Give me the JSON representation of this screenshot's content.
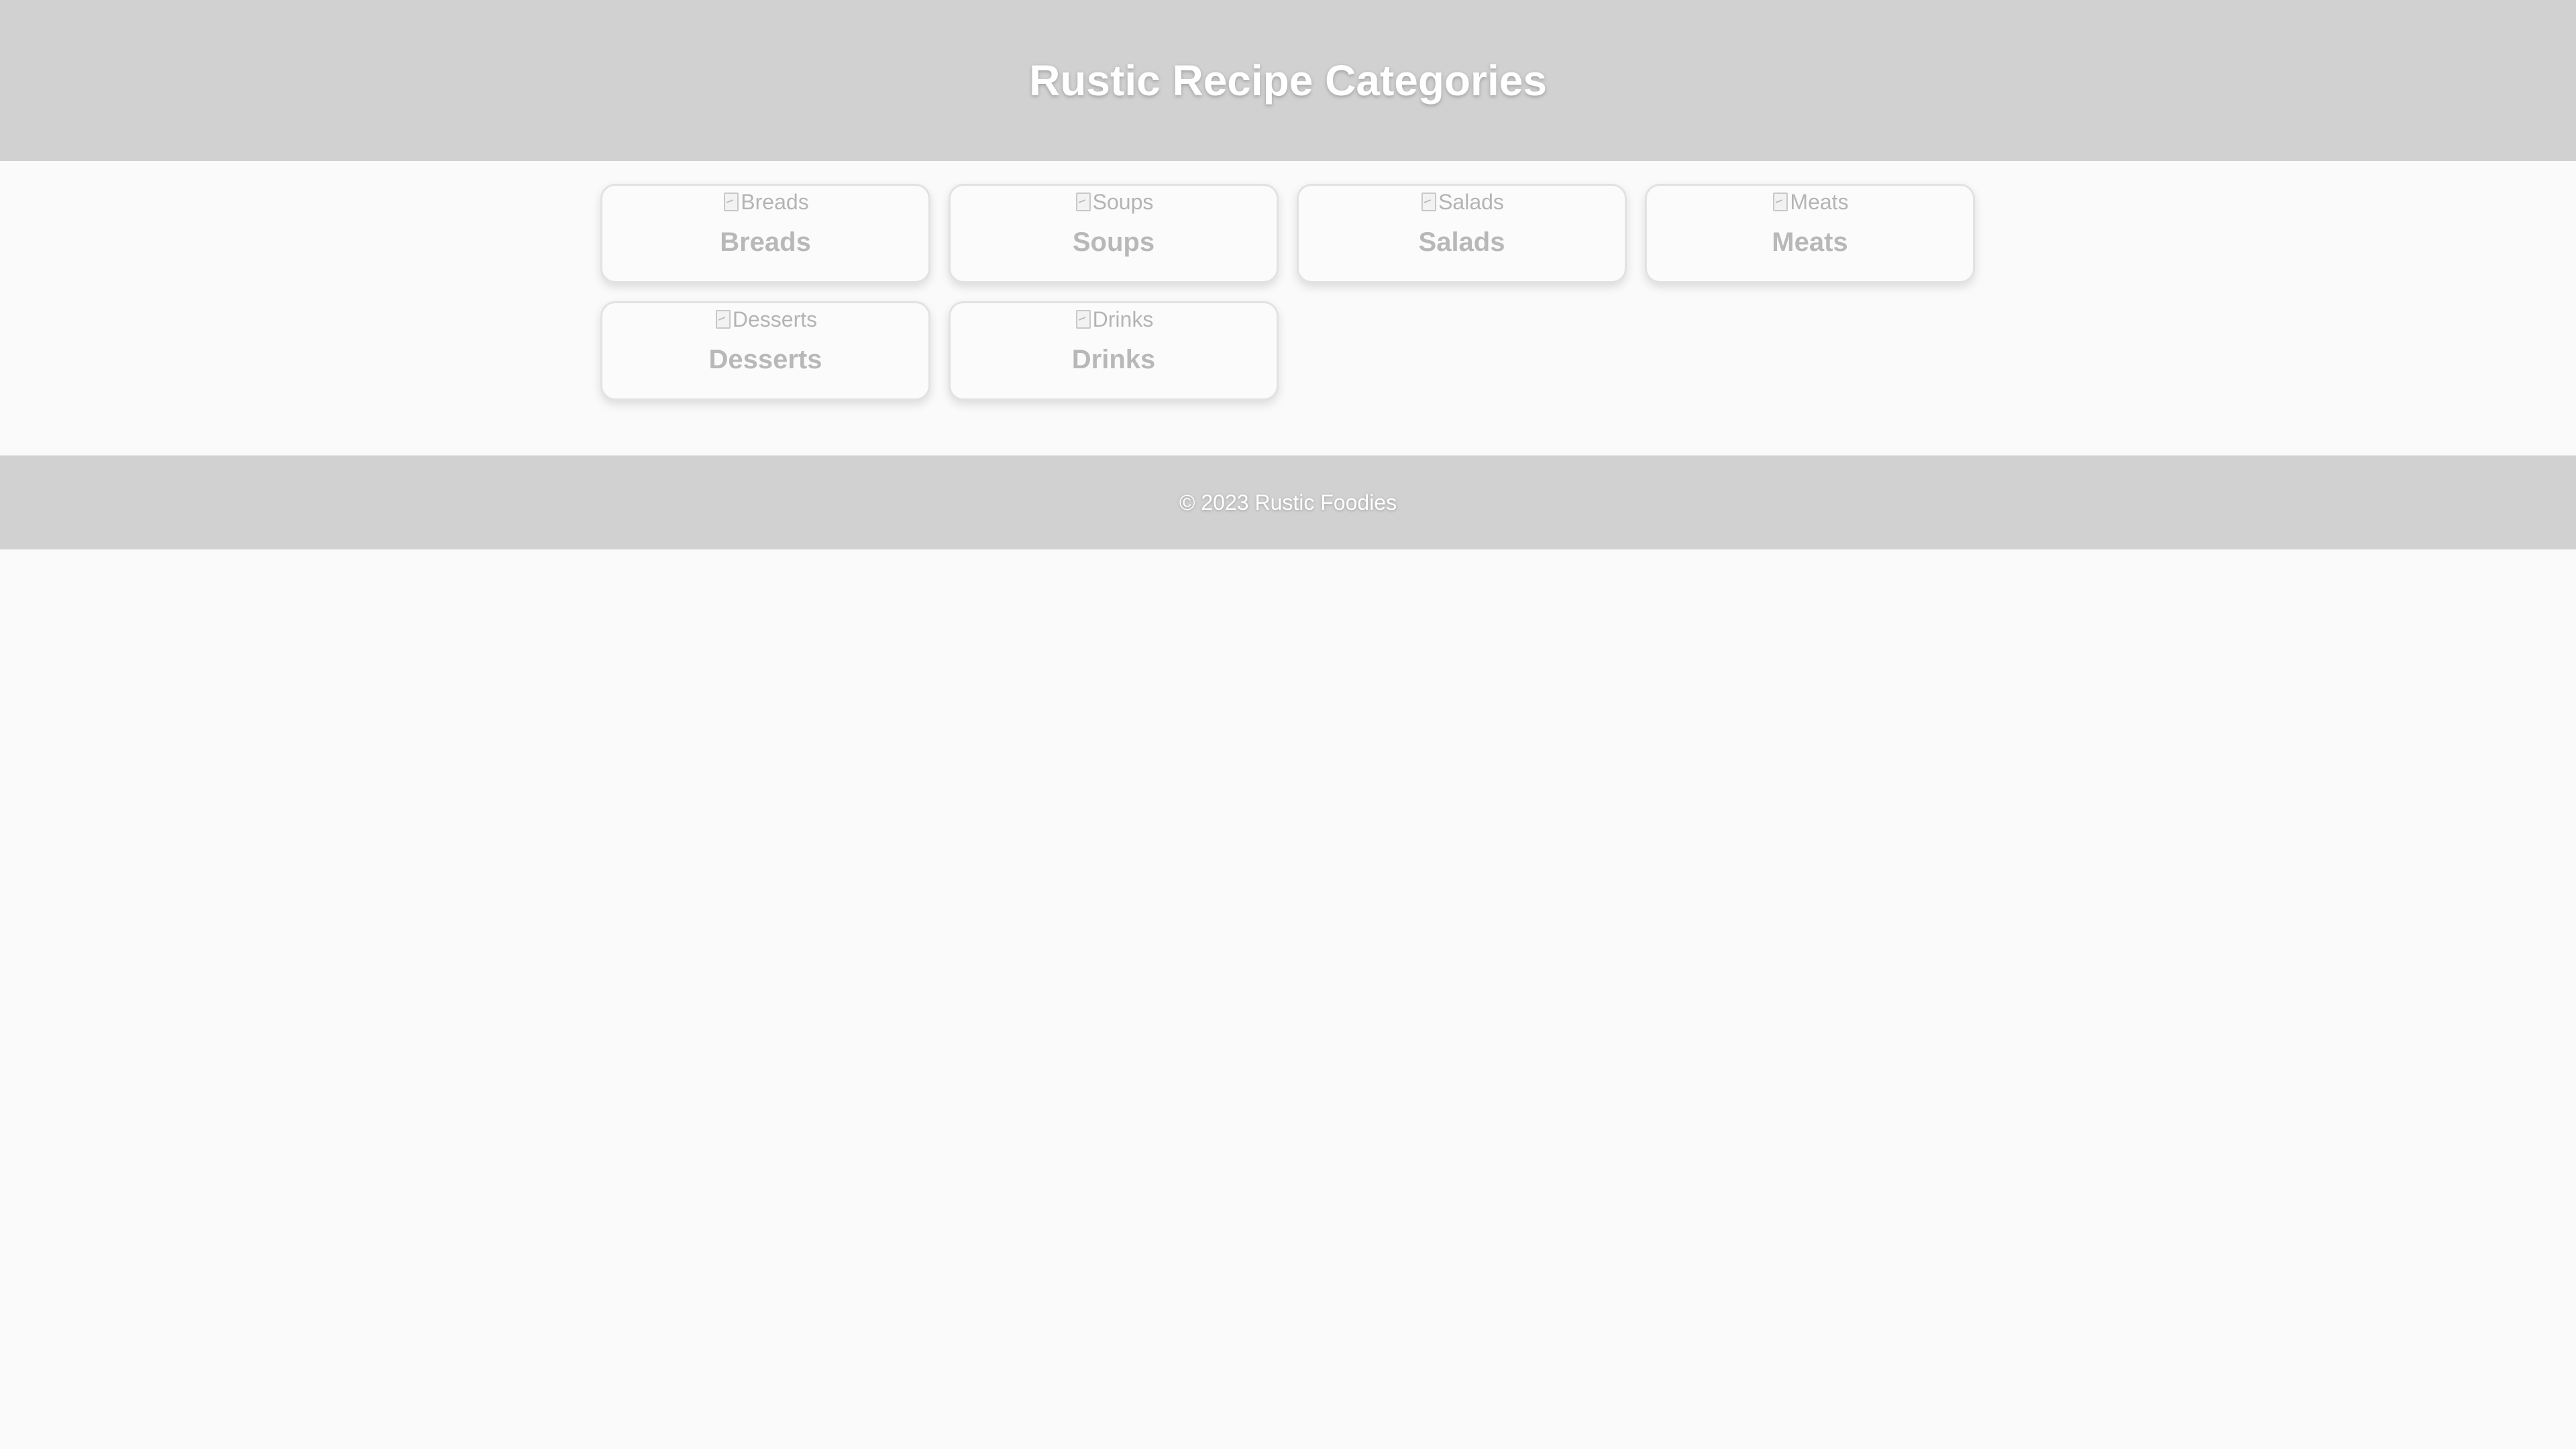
{
  "header": {
    "title": "Rustic Recipe Categories"
  },
  "categories": [
    {
      "label": "Breads",
      "image_alt": "Breads"
    },
    {
      "label": "Soups",
      "image_alt": "Soups"
    },
    {
      "label": "Salads",
      "image_alt": "Salads"
    },
    {
      "label": "Meats",
      "image_alt": "Meats"
    },
    {
      "label": "Desserts",
      "image_alt": "Desserts"
    },
    {
      "label": "Drinks",
      "image_alt": "Drinks"
    }
  ],
  "footer": {
    "copyright": "© 2023 Rustic Foodies"
  },
  "colors": {
    "header_bg": "#d1d1d1",
    "page_bg": "#fafafa",
    "card_text": "#b8b8b8"
  },
  "icons": {
    "image_placeholder": "broken-image-icon"
  }
}
